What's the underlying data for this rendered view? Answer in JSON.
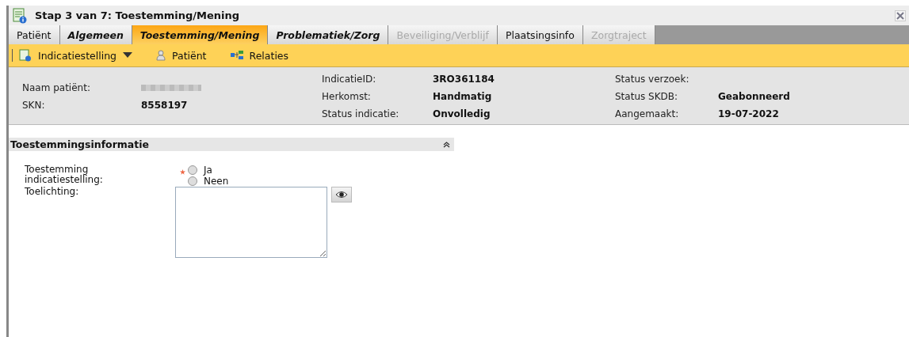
{
  "window": {
    "title": "Stap 3 van 7: Toestemming/Mening"
  },
  "tabs": [
    {
      "label": "Patiënt",
      "selected": false,
      "emphasized": false,
      "disabled": false
    },
    {
      "label": "Algemeen",
      "selected": false,
      "emphasized": true,
      "disabled": false
    },
    {
      "label": "Toestemming/Mening",
      "selected": true,
      "emphasized": true,
      "disabled": false
    },
    {
      "label": "Problematiek/Zorg",
      "selected": false,
      "emphasized": true,
      "disabled": false
    },
    {
      "label": "Beveiliging/Verblijf",
      "selected": false,
      "emphasized": false,
      "disabled": true
    },
    {
      "label": "Plaatsingsinfo",
      "selected": false,
      "emphasized": false,
      "disabled": false
    },
    {
      "label": "Zorgtraject",
      "selected": false,
      "emphasized": false,
      "disabled": true
    }
  ],
  "toolbar": [
    {
      "kind": "menu",
      "label": "Indicatiestelling"
    },
    {
      "kind": "person",
      "label": "Patiënt"
    },
    {
      "kind": "relations",
      "label": "Relaties"
    }
  ],
  "info": {
    "columns": [
      [
        {
          "kind": "redacted",
          "label": "Naam patiënt:"
        },
        {
          "kind": "value",
          "label": "SKN:",
          "value": "8558197"
        }
      ],
      [
        {
          "kind": "value",
          "label": "IndicatieID:",
          "value": "3RO361184"
        },
        {
          "kind": "value",
          "label": "Herkomst:",
          "value": "Handmatig"
        },
        {
          "kind": "value",
          "label": "Status indicatie:",
          "value": "Onvolledig"
        }
      ],
      [
        {
          "kind": "empty",
          "label": "Status verzoek:"
        },
        {
          "kind": "value",
          "label": "Status SKDB:",
          "value": "Geabonneerd"
        },
        {
          "kind": "value",
          "label": "Aangemaakt:",
          "value": "19-07-2022"
        }
      ]
    ]
  },
  "section": {
    "title": "Toestemmingsinformatie",
    "expanded": true,
    "consent": {
      "label": "Toestemming indicatiestelling:",
      "required": true,
      "options": [
        {
          "label": "Ja",
          "selected": false
        },
        {
          "label": "Neen",
          "selected": false
        }
      ]
    },
    "note": {
      "label": "Toelichting:"
    }
  }
}
